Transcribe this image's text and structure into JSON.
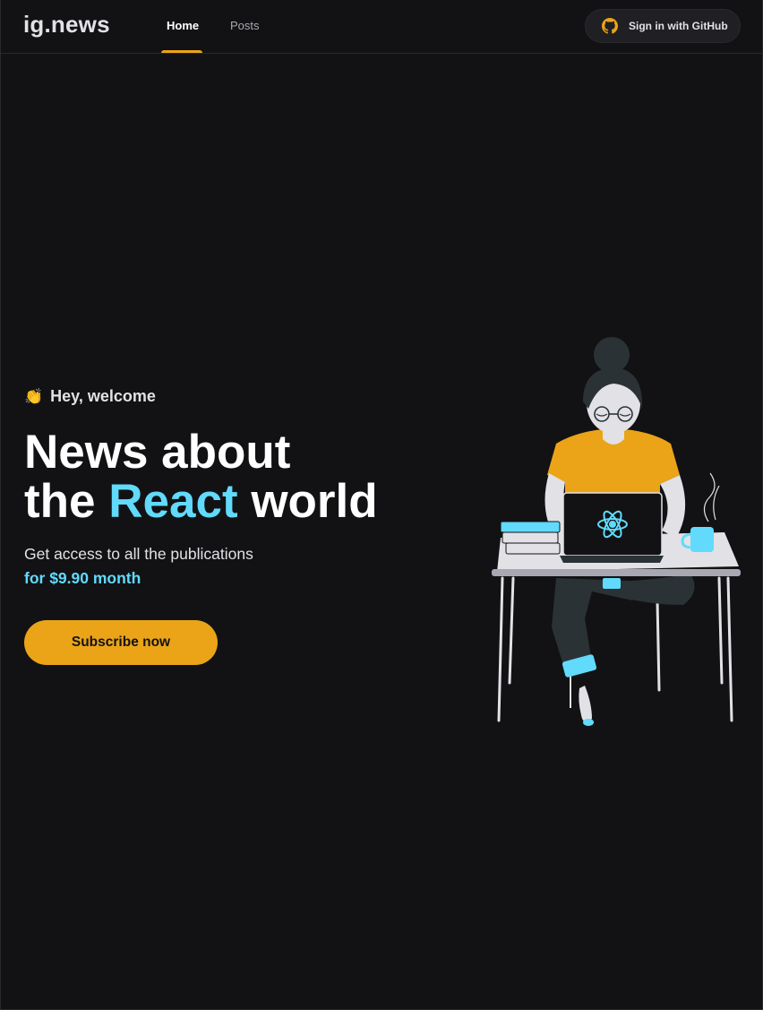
{
  "header": {
    "logo": "ig.news",
    "nav": [
      {
        "label": "Home",
        "active": true
      },
      {
        "label": "Posts",
        "active": false
      }
    ],
    "signin_label": "Sign in with GitHub",
    "signin_icon": "github-icon"
  },
  "hero": {
    "greeting_icon": "waving-hand-icon",
    "greeting_emoji": "👏",
    "greeting": "Hey, welcome",
    "headline_line1": "News about",
    "headline_prefix": "the",
    "headline_accent": "React",
    "headline_suffix": "world",
    "subtext": "Get access to all the publications",
    "price_text": "for $9.90 month",
    "cta_label": "Subscribe now",
    "illustration": "woman-coding-at-desk-illustration"
  },
  "colors": {
    "background": "#121214",
    "accent_yellow": "#eba417",
    "accent_cyan": "#61dafb",
    "header_border": "#29292e"
  }
}
